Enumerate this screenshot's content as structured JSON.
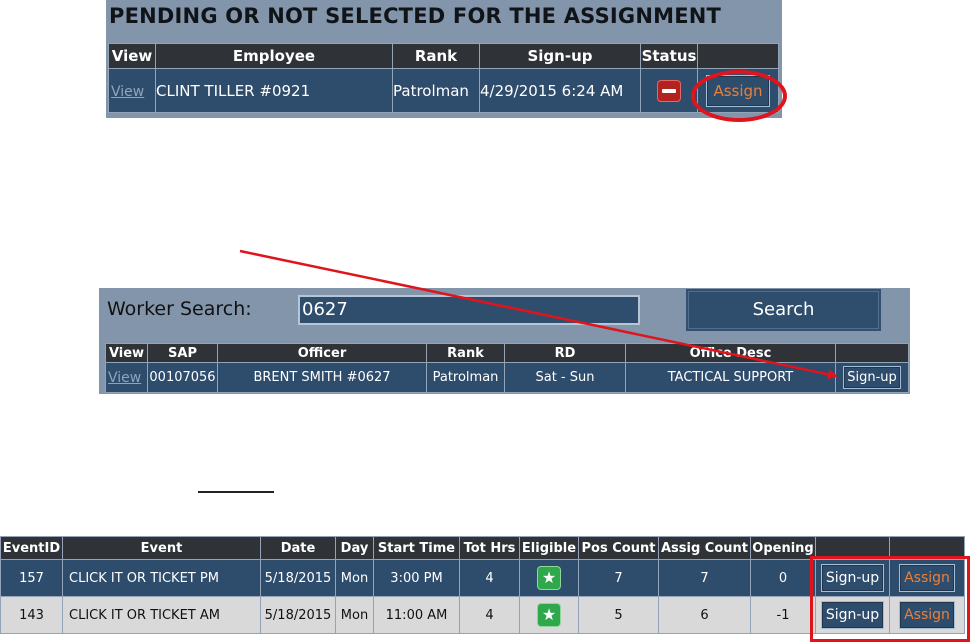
{
  "pending": {
    "title": "PENDING OR NOT SELECTED FOR THE ASSIGNMENT",
    "headers": [
      "View",
      "Employee",
      "Rank",
      "Sign-up",
      "Status",
      ""
    ],
    "row": {
      "view": "View",
      "employee": "CLINT TILLER #0921",
      "rank": "Patrolman",
      "signup": "4/29/2015 6:24 AM",
      "status_icon": "remove-icon",
      "assign": "Assign"
    }
  },
  "worker_search": {
    "label": "Worker Search:",
    "value": "0627",
    "search_button": "Search",
    "headers": [
      "View",
      "SAP",
      "Officer",
      "Rank",
      "RD",
      "Office Desc",
      ""
    ],
    "row": {
      "view": "View",
      "sap": "00107056",
      "officer": "BRENT SMITH #0627",
      "rank": "Patrolman",
      "rd": "Sat - Sun",
      "office_desc": "TACTICAL SUPPORT",
      "signup": "Sign-up"
    }
  },
  "events": {
    "headers": [
      "EventID",
      "Event",
      "Date",
      "Day",
      "Start Time",
      "Tot Hrs",
      "Eligible",
      "Pos Count",
      "Assig Count",
      "Opening",
      "",
      ""
    ],
    "rows": [
      {
        "id": "157",
        "event": "CLICK IT OR TICKET PM",
        "date": "5/18/2015",
        "day": "Mon",
        "start": "3:00 PM",
        "hrs": "4",
        "eligible_icon": "star-icon",
        "pos": "7",
        "assig": "7",
        "opening": "0",
        "signup": "Sign-up",
        "assign": "Assign"
      },
      {
        "id": "143",
        "event": "CLICK IT OR TICKET AM",
        "date": "5/18/2015",
        "day": "Mon",
        "start": "11:00 AM",
        "hrs": "4",
        "eligible_icon": "star-icon",
        "pos": "5",
        "assig": "6",
        "opening": "-1",
        "signup": "Sign-up",
        "assign": "Assign"
      }
    ]
  },
  "colors": {
    "panel_bg": "#8295ab",
    "header_bg": "#2f3337",
    "row_bg": "#2e4c6c",
    "alt_row_bg": "#d9d9d9",
    "assign_text": "#e9803a",
    "annotation_red": "#e0141c",
    "eligible_green": "#2fa84b"
  }
}
